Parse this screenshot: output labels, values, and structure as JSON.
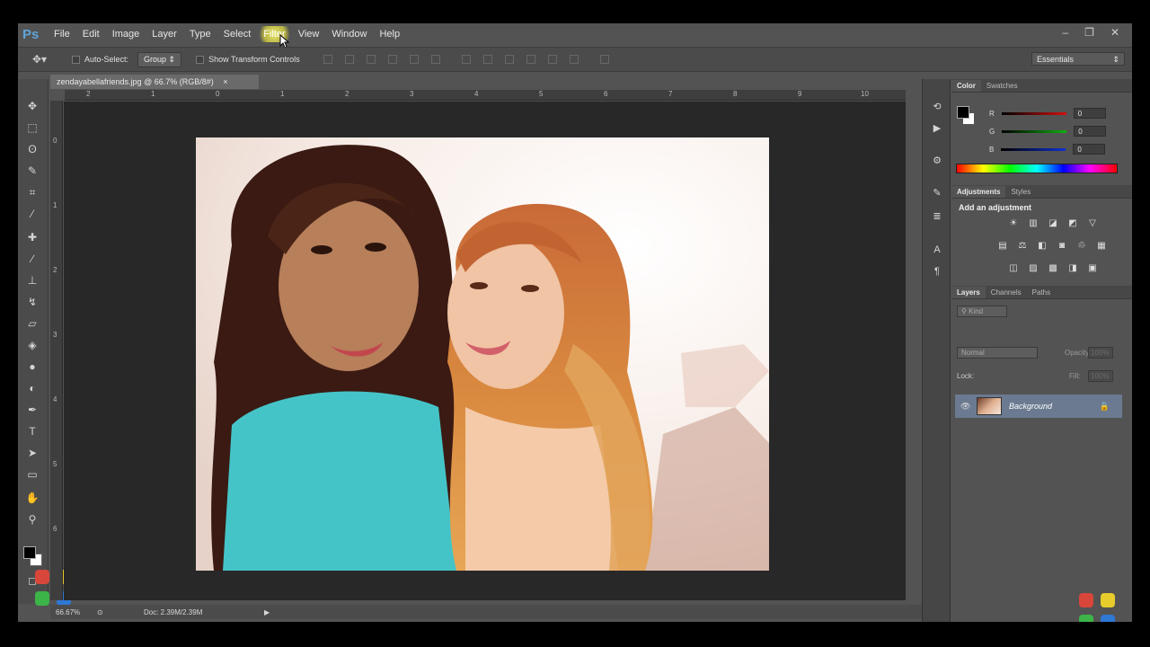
{
  "app": {
    "logo": "Ps"
  },
  "menu": [
    "File",
    "Edit",
    "Image",
    "Layer",
    "Type",
    "Select",
    "Filter",
    "View",
    "Window",
    "Help"
  ],
  "menu_active": "Filter",
  "window_controls": [
    "–",
    "❐",
    "✕"
  ],
  "options_bar": {
    "auto_select_label": "Auto-Select:",
    "auto_select_value": "Group",
    "show_transform_label": "Show Transform Controls",
    "workspace": "Essentials"
  },
  "document": {
    "tab_title": "zendayabellafriends.jpg @ 66.7% (RGB/8#)",
    "close": "×",
    "zoom": "66.67%",
    "doc_info": "Doc: 2.39M/2.39M"
  },
  "rulers": {
    "h": [
      "2",
      "1",
      "0",
      "1",
      "2",
      "3",
      "4",
      "5",
      "6",
      "7",
      "8",
      "9",
      "10"
    ],
    "v": [
      "0",
      "1",
      "2",
      "3",
      "4",
      "5",
      "6"
    ]
  },
  "color_panel": {
    "tabs": [
      "Color",
      "Swatches"
    ],
    "channels": [
      {
        "label": "R",
        "value": "0",
        "color": "#d01010"
      },
      {
        "label": "G",
        "value": "0",
        "color": "#10b010"
      },
      {
        "label": "B",
        "value": "0",
        "color": "#1030d0"
      }
    ]
  },
  "adjustments_panel": {
    "tabs": [
      "Adjustments",
      "Styles"
    ],
    "title": "Add an adjustment"
  },
  "layers_panel": {
    "tabs": [
      "Layers",
      "Channels",
      "Paths"
    ],
    "kind": "Kind",
    "blend_mode": "Normal",
    "opacity_label": "Opacity:",
    "opacity_value": "100%",
    "lock_label": "Lock:",
    "fill_label": "Fill:",
    "fill_value": "100%",
    "layer_name": "Background"
  },
  "colors": {
    "accent": "#5fa4d8",
    "panel_bg": "#535353",
    "canvas_bg": "#282828",
    "selected_layer": "#6b7a90"
  }
}
